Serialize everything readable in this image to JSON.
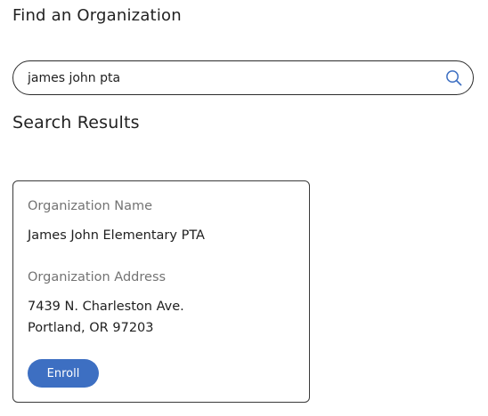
{
  "page": {
    "title": "Find an Organization"
  },
  "search": {
    "value": "james john pta",
    "icon": "search-icon"
  },
  "results": {
    "heading": "Search Results",
    "items": [
      {
        "name_label": "Organization Name",
        "name": "James John Elementary PTA",
        "address_label": "Organization Address",
        "address_line1": "7439 N. Charleston Ave.",
        "address_line2": "Portland, OR 97203",
        "enroll_label": "Enroll"
      }
    ]
  },
  "colors": {
    "accent": "#3d6fc2",
    "search_icon": "#3d6fc2",
    "label_gray": "#737373"
  }
}
